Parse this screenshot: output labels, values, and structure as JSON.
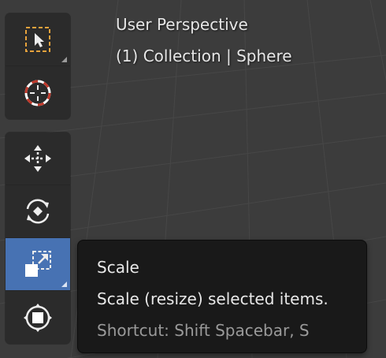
{
  "viewport": {
    "view_name": "User Perspective",
    "object_info": "(1) Collection | Sphere"
  },
  "toolbar": {
    "groups": [
      {
        "tools": [
          {
            "name": "Select Box",
            "icon": "select-box-icon",
            "has_submenu": true,
            "active": false
          },
          {
            "name": "Cursor",
            "icon": "cursor-target-icon",
            "has_submenu": false,
            "active": false
          }
        ]
      },
      {
        "tools": [
          {
            "name": "Move",
            "icon": "move-icon",
            "has_submenu": false,
            "active": false
          },
          {
            "name": "Rotate",
            "icon": "rotate-icon",
            "has_submenu": false,
            "active": false
          },
          {
            "name": "Scale",
            "icon": "scale-icon",
            "has_submenu": true,
            "active": true
          },
          {
            "name": "Transform",
            "icon": "transform-icon",
            "has_submenu": false,
            "active": false
          }
        ]
      }
    ]
  },
  "tooltip": {
    "title": "Scale",
    "description": "Scale (resize) selected items.",
    "shortcut": "Shortcut: Shift Spacebar, S"
  },
  "colors": {
    "viewport_bg": "#3c3c3c",
    "grid_line": "#4a4a4a",
    "toolbar_bg": "#2b2b2b",
    "active_tool": "#4772b3",
    "tooltip_bg": "#191919",
    "select_dash": "#e8a33c",
    "cursor_red": "#c0392b"
  }
}
